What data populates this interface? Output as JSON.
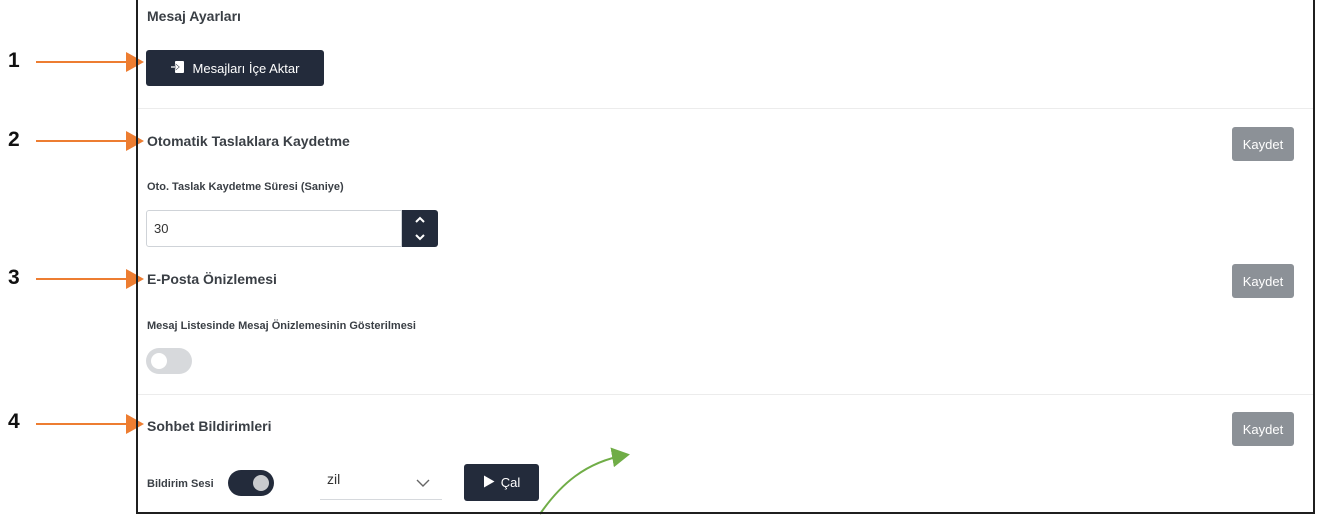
{
  "markers": [
    "1",
    "2",
    "3",
    "4"
  ],
  "section_title": "Mesaj Ayarları",
  "import_button_label": "Mesajları İçe Aktar",
  "draft": {
    "title": "Otomatik Taslaklara Kaydetme",
    "save_label": "Kaydet",
    "field_label": "Oto. Taslak Kaydetme Süresi (Saniye)",
    "field_value": "30"
  },
  "preview": {
    "title": "E-Posta Önizlemesi",
    "save_label": "Kaydet",
    "toggle_label": "Mesaj Listesinde Mesaj Önizlemesinin Gösterilmesi",
    "toggle_on": false
  },
  "chat": {
    "title": "Sohbet Bildirimleri",
    "save_label": "Kaydet",
    "sound_label": "Bildirim Sesi",
    "sound_toggle_on": true,
    "sound_select_value": "zil",
    "play_label": "Çal"
  },
  "colors": {
    "accent_arrow": "#ed7d31",
    "green_arrow": "#70ad47",
    "dark_button": "#232b3b",
    "save_button": "#8c9197"
  }
}
